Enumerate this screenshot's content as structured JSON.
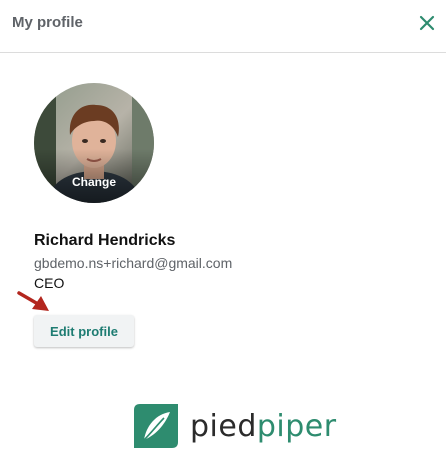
{
  "header": {
    "title": "My profile",
    "close_icon": "close-icon"
  },
  "profile": {
    "avatar_change_label": "Change",
    "name": "Richard Hendricks",
    "email": "gbdemo.ns+richard@gmail.com",
    "role": "CEO",
    "edit_button_label": "Edit profile"
  },
  "annotation": {
    "arrow_icon": "red-arrow-icon",
    "color": "#b3261e"
  },
  "brand": {
    "logo_part1": "pied",
    "logo_part2": "piper",
    "logo_icon": "leaf-logo-icon",
    "accent": "#2e8c6f",
    "button_text_color": "#1e7c72"
  }
}
